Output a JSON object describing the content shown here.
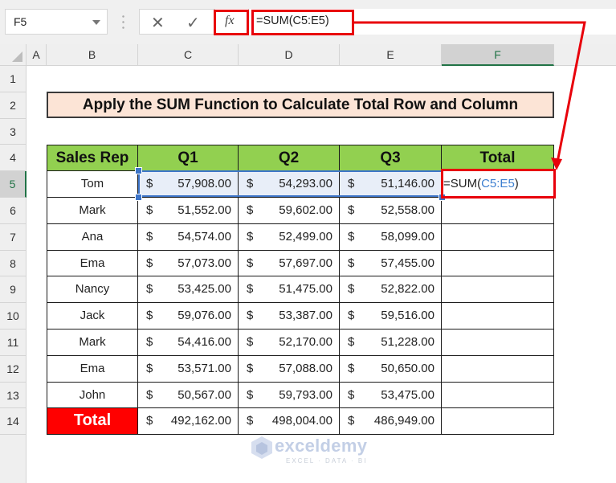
{
  "formula_bar": {
    "name_box": "F5",
    "cancel_icon": "✕",
    "enter_icon": "✓",
    "fx_label": "fx",
    "formula": "=SUM(C5:E5)"
  },
  "columns": [
    "A",
    "B",
    "C",
    "D",
    "E",
    "F"
  ],
  "selected_column": "F",
  "rows": [
    "1",
    "2",
    "3",
    "4",
    "5",
    "6",
    "7",
    "8",
    "9",
    "10",
    "11",
    "12",
    "13",
    "14"
  ],
  "selected_row": "5",
  "sheet": {
    "title": "Apply the SUM Function to Calculate Total Row and Column",
    "headers": [
      "Sales Rep",
      "Q1",
      "Q2",
      "Q3",
      "Total"
    ],
    "currency_symbol": "$",
    "data_rows": [
      {
        "name": "Tom",
        "q1": "57,908.00",
        "q2": "54,293.00",
        "q3": "51,146.00"
      },
      {
        "name": "Mark",
        "q1": "51,552.00",
        "q2": "59,602.00",
        "q3": "52,558.00"
      },
      {
        "name": "Ana",
        "q1": "54,574.00",
        "q2": "52,499.00",
        "q3": "58,099.00"
      },
      {
        "name": "Ema",
        "q1": "57,073.00",
        "q2": "57,697.00",
        "q3": "57,455.00"
      },
      {
        "name": "Nancy",
        "q1": "53,425.00",
        "q2": "51,475.00",
        "q3": "52,822.00"
      },
      {
        "name": "Jack",
        "q1": "59,076.00",
        "q2": "53,387.00",
        "q3": "59,516.00"
      },
      {
        "name": "Mark",
        "q1": "54,416.00",
        "q2": "52,170.00",
        "q3": "51,228.00"
      },
      {
        "name": "Ema",
        "q1": "53,571.00",
        "q2": "57,088.00",
        "q3": "50,650.00"
      },
      {
        "name": "John",
        "q1": "50,567.00",
        "q2": "59,793.00",
        "q3": "53,475.00"
      }
    ],
    "total_row": {
      "label": "Total",
      "q1": "492,162.00",
      "q2": "498,004.00",
      "q3": "486,949.00"
    },
    "f5_formula": {
      "prefix": "=SUM(",
      "ref": "C5:E5",
      "suffix": ")"
    }
  },
  "colors": {
    "header_green": "#92d050",
    "title_fill": "#fce4d6",
    "total_red": "#ff0000",
    "annotation_red": "#e8000b",
    "selection_blue": "#3c74c8",
    "excel_green": "#217346"
  },
  "watermark": {
    "brand": "exceldemy",
    "tagline": "EXCEL · DATA · BI"
  }
}
